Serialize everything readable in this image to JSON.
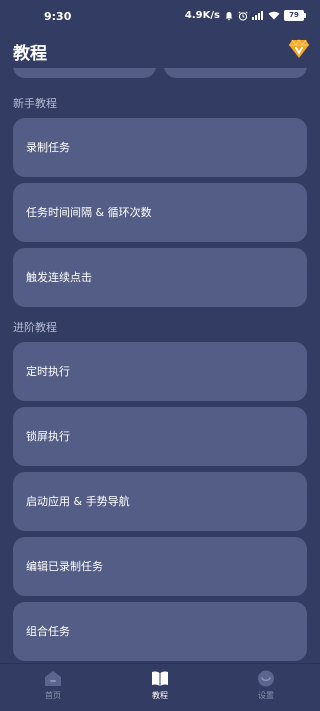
{
  "status_bar": {
    "time": "9:30",
    "speed": "4.9K/s",
    "battery": "79"
  },
  "header": {
    "title": "教程",
    "vip_icon": "vip-diamond-icon"
  },
  "sections": [
    {
      "label": "新手教程",
      "items": [
        {
          "label": "录制任务"
        },
        {
          "label": "任务时间间隔 & 循环次数"
        },
        {
          "label": "触发连续点击"
        }
      ]
    },
    {
      "label": "进阶教程",
      "items": [
        {
          "label": "定时执行"
        },
        {
          "label": "锁屏执行"
        },
        {
          "label": "启动应用 & 手势导航"
        },
        {
          "label": "编辑已录制任务"
        },
        {
          "label": "组合任务"
        }
      ]
    }
  ],
  "bottom_nav": {
    "items": [
      {
        "label": "首页",
        "icon": "home-icon",
        "active": false
      },
      {
        "label": "教程",
        "icon": "book-icon",
        "active": true
      },
      {
        "label": "设置",
        "icon": "settings-icon",
        "active": false
      }
    ]
  },
  "colors": {
    "background": "#333d63",
    "card": "#535d86",
    "section_label": "#b4bbd3",
    "accent": "#f5a623"
  }
}
